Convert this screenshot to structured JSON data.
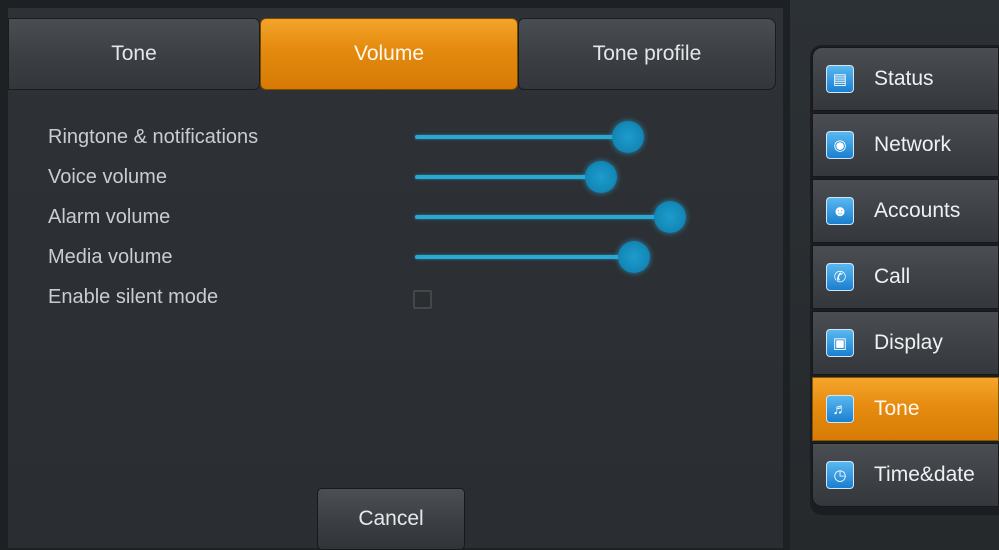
{
  "tabs": [
    {
      "label": "Tone",
      "active": false
    },
    {
      "label": "Volume",
      "active": true
    },
    {
      "label": "Tone profile",
      "active": false
    }
  ],
  "settings": {
    "ringtone": {
      "label": "Ringtone & notifications",
      "level": 0.71
    },
    "voice": {
      "label": "Voice volume",
      "level": 0.62
    },
    "alarm": {
      "label": "Alarm volume",
      "level": 0.85
    },
    "media": {
      "label": "Media volume",
      "level": 0.73
    },
    "silent": {
      "label": "Enable silent mode",
      "checked": false
    }
  },
  "cancel_label": "Cancel",
  "sidebar": {
    "items": [
      {
        "label": "Status",
        "icon": "status-icon",
        "active": false
      },
      {
        "label": "Network",
        "icon": "globe-icon",
        "active": false
      },
      {
        "label": "Accounts",
        "icon": "accounts-icon",
        "active": false
      },
      {
        "label": "Call",
        "icon": "phone-icon",
        "active": false
      },
      {
        "label": "Display",
        "icon": "monitor-icon",
        "active": false
      },
      {
        "label": "Tone",
        "icon": "speaker-icon",
        "active": true
      },
      {
        "label": "Time&date",
        "icon": "clock-icon",
        "active": false
      }
    ]
  },
  "colors": {
    "accent_orange": "#e68c10",
    "slider_blue": "#29a8d4",
    "icon_blue": "#1a7fd0"
  }
}
